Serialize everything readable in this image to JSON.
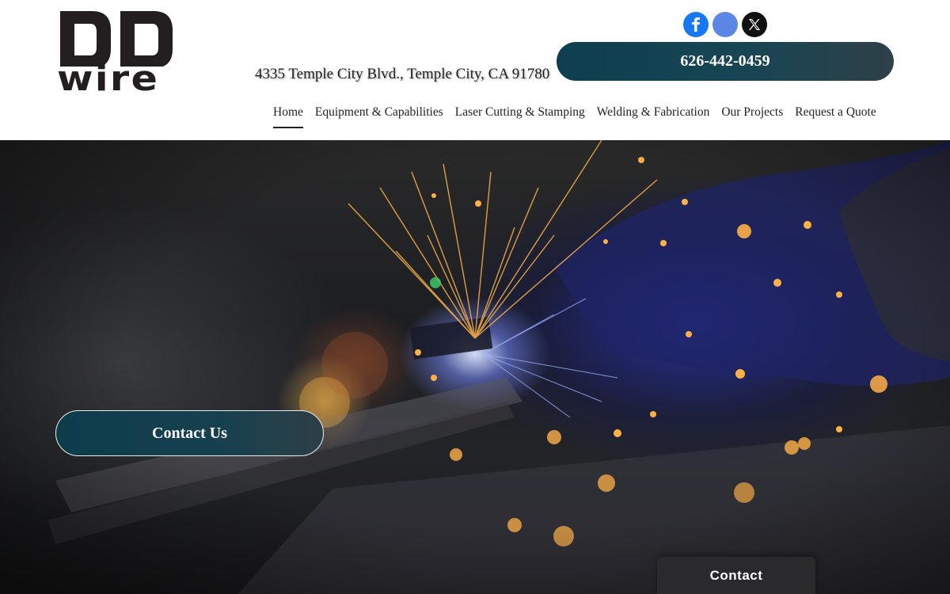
{
  "header": {
    "logo_text": "wire",
    "logo_alt": "DD",
    "address": "4335 Temple City Blvd., Temple City, CA 91780",
    "phone": "626-442-0459",
    "socials": [
      {
        "name": "facebook",
        "icon": "facebook-icon"
      },
      {
        "name": "google",
        "icon": "google-icon"
      },
      {
        "name": "x",
        "icon": "x-icon"
      }
    ]
  },
  "nav": {
    "items": [
      {
        "label": "Home",
        "active": true
      },
      {
        "label": "Equipment & Capabilities"
      },
      {
        "label": "Laser Cutting & Stamping"
      },
      {
        "label": "Welding & Fabrication"
      },
      {
        "label": "Our Projects"
      },
      {
        "label": "Request a Quote"
      }
    ]
  },
  "hero": {
    "cta_label": "Contact Us",
    "image": "welding-sparks-photo"
  },
  "floating": {
    "contact_label": "Contact"
  },
  "colors": {
    "button_gradient_start": "#0e3f4f",
    "button_gradient_end": "#2f4048",
    "facebook": "#1877f2",
    "google": "#5b86e5"
  }
}
